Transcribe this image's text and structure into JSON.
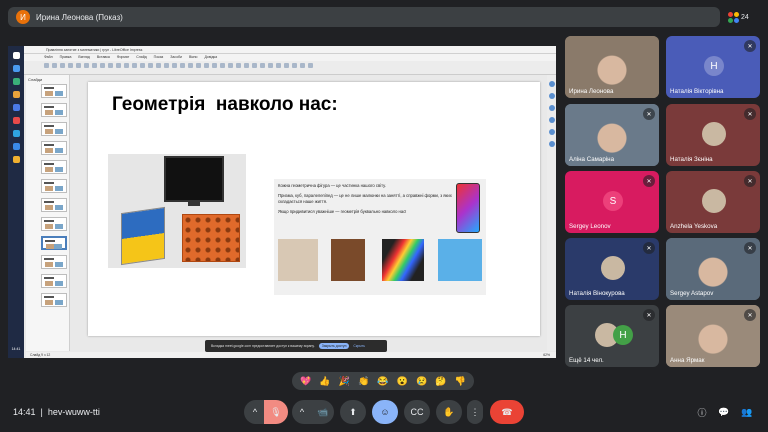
{
  "meeting": {
    "presenter_initial": "И",
    "presenter_title": "Ирина Леонова (Показ)",
    "participant_count": "24",
    "time": "14:41",
    "meeting_code": "hev-wuww-tti"
  },
  "libreoffice": {
    "window_title": "Правління занятие з математики | груп - LibreOffice Impress",
    "menu": "Файл Правка Вигляд Вставка Формат Слайд Показ Засоби Вікно Довідка",
    "panel_label": "Слайди",
    "status_left": "Слайд 9 з 12",
    "status_right": "62%"
  },
  "slide": {
    "title": "Геометрія  навколо нас:",
    "paragraph1": "Кожна геометрична фігура — це частинка нашого світу.",
    "paragraph2": "Призма, куб, паралелепіпед — це не лише малюнки на занятті, а справжні форми, з яких складається наше життя.",
    "paragraph3": "Якщо придивитися уважніше — геометрія буквально навколо нас!"
  },
  "share_notice": {
    "text": "Вкладка meet.google.com предоставляет доступ к вашему экрану.",
    "stop_label": "Закрыть доступ",
    "hide_label": "Скрыть"
  },
  "participants": [
    {
      "name": "Ирина Леонова",
      "type": "video",
      "color": "#8a7a6a"
    },
    {
      "name": "Наталія Вікторівна",
      "type": "initial",
      "initial": "Н",
      "color": "#4a5cb8"
    },
    {
      "name": "Аліна Самаріна",
      "type": "video",
      "color": "#6a7a8a"
    },
    {
      "name": "Наталія Зєніна",
      "type": "photo",
      "color": "#7a3a3a"
    },
    {
      "name": "Sergey Leonov",
      "type": "initial",
      "initial": "S",
      "color": "#d81b60"
    },
    {
      "name": "Anzhela Yeskova",
      "type": "photo",
      "color": "#7a3a3a"
    },
    {
      "name": "Наталія Вінокурова",
      "type": "photo",
      "color": "#2a3a6a"
    },
    {
      "name": "Sergey Astapov",
      "type": "video",
      "color": "#5a6a7a"
    },
    {
      "name": "Ещё 14 чел.",
      "type": "group",
      "initial": "H",
      "color": "#3c4043"
    },
    {
      "name": "Анна Ярмак",
      "type": "video",
      "color": "#9a8a7a"
    }
  ],
  "reactions": [
    "💖",
    "👍",
    "🎉",
    "👏",
    "😂",
    "😮",
    "😢",
    "🤔",
    "👎"
  ],
  "controls": {
    "more_arrow": "^",
    "mic": "🎙",
    "cam_arrow": "^",
    "camera": "📹",
    "present": "⬆",
    "emoji": "☺",
    "captions": "CC",
    "hand": "✋",
    "more": "⋮",
    "hangup": "☎"
  },
  "right_icons": {
    "info": "ⓘ",
    "chat": "💬",
    "people": "👥",
    "activities": "⊞"
  }
}
